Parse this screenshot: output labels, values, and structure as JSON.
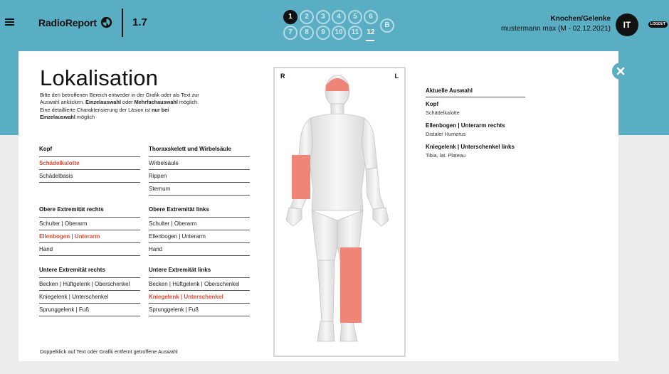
{
  "header": {
    "brand": "RadioReport",
    "version": "1.7",
    "steps": [
      {
        "label": "1",
        "state": "active"
      },
      {
        "label": "2",
        "state": "normal"
      },
      {
        "label": "3",
        "state": "normal"
      },
      {
        "label": "4",
        "state": "normal"
      },
      {
        "label": "5",
        "state": "normal"
      },
      {
        "label": "6",
        "state": "normal"
      },
      {
        "label": "7",
        "state": "normal"
      },
      {
        "label": "8",
        "state": "normal"
      },
      {
        "label": "9",
        "state": "normal"
      },
      {
        "label": "10",
        "state": "normal"
      },
      {
        "label": "11",
        "state": "normal"
      },
      {
        "label": "12",
        "state": "current"
      },
      {
        "label": "B",
        "state": "normal"
      }
    ],
    "module": "Knochen/Gelenke",
    "patient": "mustermann max (M - 02.12.2021)",
    "avatar": "IT",
    "logout": "LOGOUT"
  },
  "panel": {
    "title": "Lokalisation",
    "intro": {
      "t1": "Bitte den betroffenen Bereich entweder in der Grafik oder als Text zur Auswahl anklicken. ",
      "b1": "Einzelauswahl",
      "t2": " oder ",
      "b2": "Mehrfachauswahl",
      "t3": " möglich. Eine detaillierte Charakterisierung der Läsion ist ",
      "b3": "nur bei Einzelauswahl",
      "t4": " möglich"
    },
    "hint": "Doppelklick auf Text oder Grafik entfernt getroffene Auswahl",
    "figure": {
      "left": "R",
      "right": "L",
      "highlight_color": "#ee8577",
      "selected_color": "#e04a33"
    },
    "groups": [
      {
        "header": "Kopf",
        "items": [
          {
            "label": "Schädelkalotte",
            "selected": true
          },
          {
            "label": "Schädelbasis",
            "selected": false
          }
        ]
      },
      {
        "header": "Thoraxskelett und Wirbelsäule",
        "items": [
          {
            "label": "Wirbelsäule",
            "selected": false
          },
          {
            "label": "Rippen",
            "selected": false
          },
          {
            "label": "Sternum",
            "selected": false
          }
        ]
      },
      {
        "header": "Obere Extremität rechts",
        "items": [
          {
            "label": "Schulter | Oberarm",
            "selected": false
          },
          {
            "label": "Ellenbogen | Unterarm",
            "selected": true
          },
          {
            "label": "Hand",
            "selected": false
          }
        ]
      },
      {
        "header": "Obere Extremität links",
        "items": [
          {
            "label": "Schulter | Oberarm",
            "selected": false
          },
          {
            "label": "Ellenbogen | Unterarm",
            "selected": false
          },
          {
            "label": "Hand",
            "selected": false
          }
        ]
      },
      {
        "header": "Untere Extremität rechts",
        "items": [
          {
            "label": "Becken | Hüftgelenk | Oberschenkel",
            "selected": false
          },
          {
            "label": "Kniegelenk | Unterschenkel",
            "selected": false
          },
          {
            "label": "Sprunggelenk | Fuß",
            "selected": false
          }
        ]
      },
      {
        "header": "Untere Extremität links",
        "items": [
          {
            "label": "Becken | Hüftgelenk | Oberschenkel",
            "selected": false
          },
          {
            "label": "Kniegelenk | Unterschenkel",
            "selected": true
          },
          {
            "label": "Sprunggelenk | Fuß",
            "selected": false
          }
        ]
      }
    ],
    "current": {
      "header": "Aktuelle Auswahl",
      "items": [
        {
          "title": "Kopf",
          "sub": "Schädelkalotte"
        },
        {
          "title": "Ellenbogen | Unterarm rechts",
          "sub": "Distaler Humerus"
        },
        {
          "title": "Kniegelenk | Unterschenkel links",
          "sub": "Tibia, lat. Plateau"
        }
      ]
    }
  },
  "icons": {
    "menu": "hamburger-icon",
    "logo": "radioreport-logo-icon",
    "close": "close-icon"
  }
}
